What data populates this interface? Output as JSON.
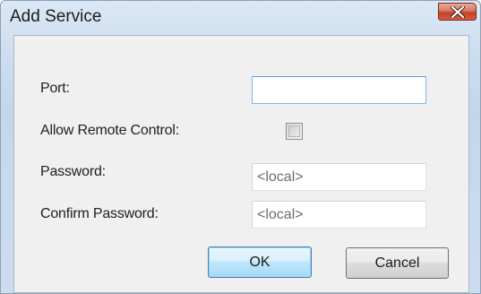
{
  "window": {
    "title": "Add Service"
  },
  "form": {
    "port": {
      "label": "Port:",
      "value": ""
    },
    "allow_remote_control": {
      "label": "Allow Remote Control:",
      "checked": false
    },
    "password": {
      "label": "Password:",
      "placeholder": "<local>"
    },
    "confirm_password": {
      "label": "Confirm Password:",
      "placeholder": "<local>"
    }
  },
  "buttons": {
    "ok_label": "OK",
    "cancel_label": "Cancel"
  },
  "icons": {
    "close": "close-icon"
  },
  "colors": {
    "close_button": "#c0422a",
    "default_button_border": "#3c7fb1"
  }
}
